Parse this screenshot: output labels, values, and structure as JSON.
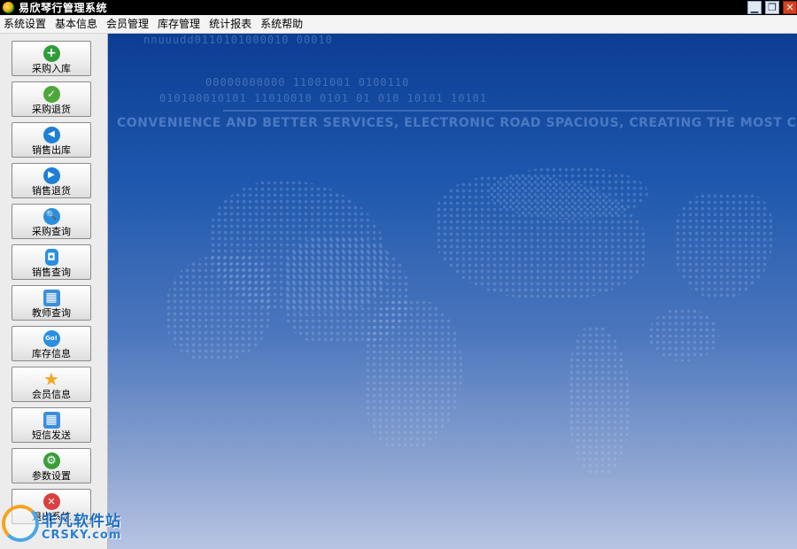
{
  "window": {
    "title": "易欣琴行管理系统",
    "controls": {
      "minimize": "▁",
      "restore": "❐",
      "close": "✕"
    }
  },
  "menu": [
    "系统设置",
    "基本信息",
    "会员管理",
    "库存管理",
    "统计报表",
    "系统帮助"
  ],
  "sidebar": {
    "buttons": [
      {
        "label": "采购入库",
        "icon": "plus-circle-icon",
        "glyph": "+",
        "color": "#2f9d3a"
      },
      {
        "label": "采购退货",
        "icon": "check-circle-icon",
        "glyph": "✓",
        "color": "#4da63a"
      },
      {
        "label": "销售出库",
        "icon": "arrow-left-circle-icon",
        "glyph": "◀",
        "color": "#1f7fd6"
      },
      {
        "label": "销售退货",
        "icon": "arrow-right-circle-icon",
        "glyph": "▶",
        "color": "#1f7fd6"
      },
      {
        "label": "采购查询",
        "icon": "magnifier-icon",
        "glyph": "🔍",
        "color": "#2a8fe0"
      },
      {
        "label": "销售查询",
        "icon": "ipod-icon",
        "glyph": "◘",
        "color": "#2a8fe0"
      },
      {
        "label": "教师查询",
        "icon": "calendar-icon",
        "glyph": "▦",
        "color": "#3a8fdc"
      },
      {
        "label": "库存信息",
        "icon": "go-icon",
        "glyph": "Go!",
        "color": "#2a8fe0"
      },
      {
        "label": "会员信息",
        "icon": "star-icon",
        "glyph": "★",
        "color": "#f5a623"
      },
      {
        "label": "短信发送",
        "icon": "calendar-icon",
        "glyph": "▦",
        "color": "#3a8fdc"
      },
      {
        "label": "参数设置",
        "icon": "gear-icon",
        "glyph": "⚙",
        "color": "#3a9d3a"
      },
      {
        "label": "退出系统",
        "icon": "close-circle-icon",
        "glyph": "✕",
        "color": "#d94040"
      }
    ]
  },
  "banner": {
    "binary_lines": [
      "nnuuudd0110101000010 00010",
      "00000000000 11001001  0100110",
      "010100010101 11010010   0101  01 010  10101 10101"
    ],
    "slogan": "CONVENIENCE AND BETTER SERVICES, ELECTRONIC ROAD SPACIOUS, CREATING THE MOST COMPETITIVE"
  },
  "watermark": {
    "brand": "非凡软件站",
    "site": "CRSKY.com"
  }
}
